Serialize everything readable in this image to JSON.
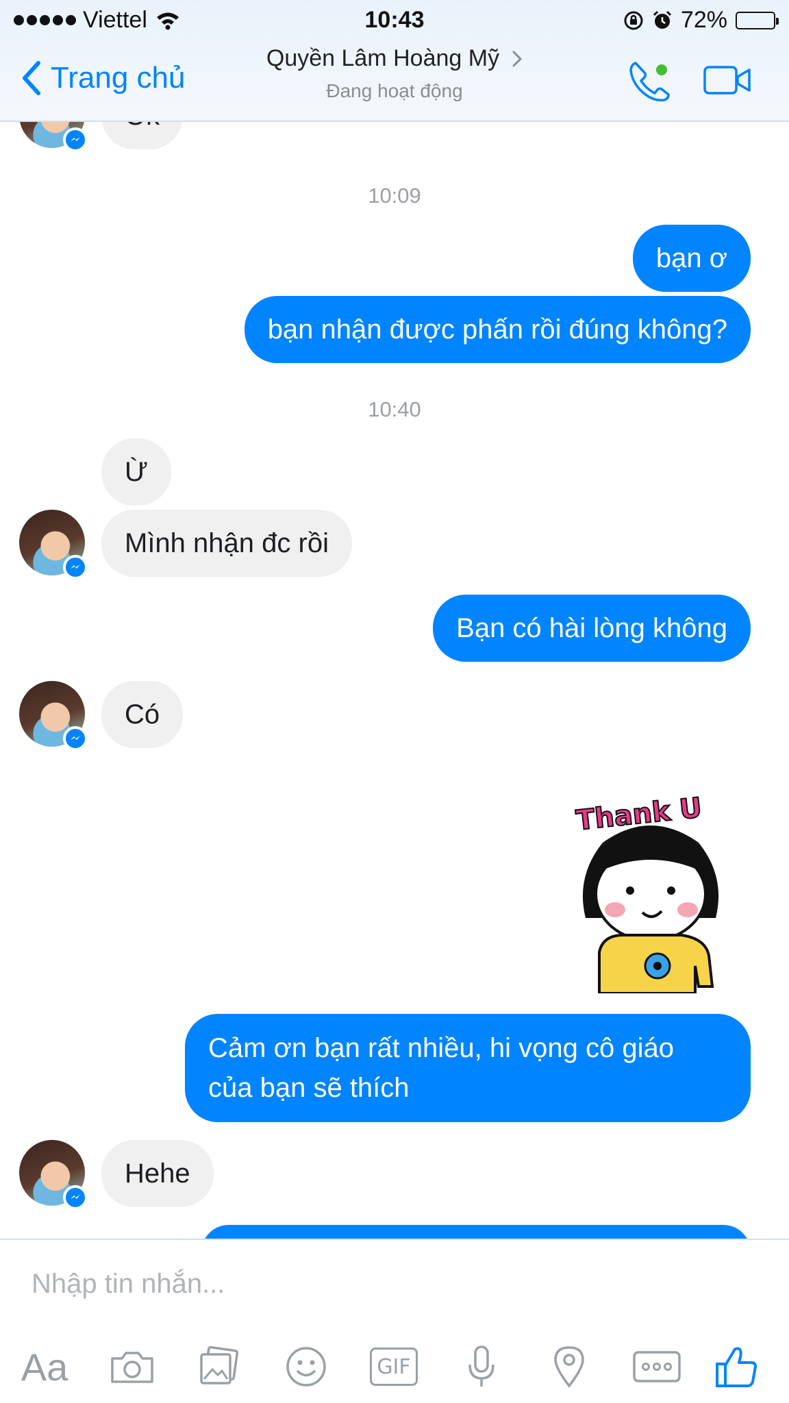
{
  "status_bar": {
    "carrier": "Viettel",
    "time": "10:43",
    "battery_percent": "72%",
    "battery_level": 0.72
  },
  "header": {
    "back_label": "Trang chủ",
    "contact_name": "Quyền Lâm Hoàng Mỹ",
    "status": "Đang hoạt động"
  },
  "messages": {
    "partial_top": "Ok",
    "timestamp_1": "10:09",
    "out_1": "bạn ơ",
    "out_2": "bạn nhận được phấn rồi đúng không?",
    "timestamp_2": "10:40",
    "in_1": "Ừ",
    "in_2": "Mình nhận đc rồi",
    "out_3": "Bạn có hài lòng không",
    "in_3": "Có",
    "sticker_text": "Thank U",
    "out_4_line1": "Cảm ơn bạn rất nhiều, hi vọng cô giáo",
    "out_4_line2": "của bạn sẽ thích",
    "in_4": "Hehe"
  },
  "composer": {
    "placeholder": "Nhập tin nhắn...",
    "text_tool_label": "Aa",
    "gif_label": "GIF"
  },
  "colors": {
    "accent": "#0084ff",
    "incoming_bubble": "#f0f0f0",
    "active_dot": "#44bd32"
  }
}
